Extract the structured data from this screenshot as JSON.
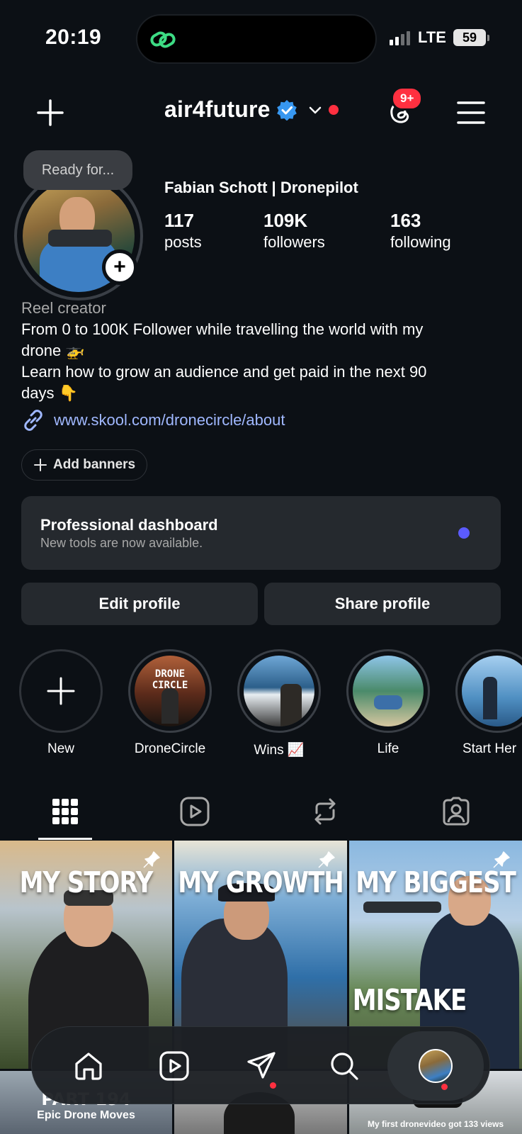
{
  "status_bar": {
    "time": "20:19",
    "network": "LTE",
    "battery": "59"
  },
  "header": {
    "username": "air4future",
    "verified": true,
    "notifications_badge": "9+"
  },
  "profile": {
    "note": "Ready for...",
    "display_name": "Fabian Schott | Dronepilot",
    "stats": [
      {
        "value": "117",
        "label": "posts"
      },
      {
        "value": "109K",
        "label": "followers"
      },
      {
        "value": "163",
        "label": "following"
      }
    ],
    "category": "Reel creator",
    "bio_line1": "From 0 to 100K Follower while travelling the world with my",
    "bio_line2": "drone 🚁",
    "bio_line3": "Learn how to grow an audience and get paid in the next 90",
    "bio_line4": "days 👇",
    "link": "www.skool.com/dronecircle/about"
  },
  "add_banners_label": "Add banners",
  "dashboard": {
    "title": "Professional dashboard",
    "subtitle": "New tools are now available."
  },
  "buttons": {
    "edit": "Edit profile",
    "share": "Share profile"
  },
  "highlights": [
    {
      "label": "New"
    },
    {
      "label": "DroneCircle",
      "cover_text": "DRONE CIRCLE"
    },
    {
      "label": "Wins 📈"
    },
    {
      "label": "Life"
    },
    {
      "label": "Start Her"
    }
  ],
  "grid_posts": [
    {
      "title": "MY STORY"
    },
    {
      "title": "MY GROWTH"
    },
    {
      "title": "MY BIGGEST",
      "title2": "MISTAKE"
    },
    {
      "title": "PART 194",
      "subtitle": "Epic Drone Moves"
    },
    {
      "title": ""
    },
    {
      "title": "",
      "caption": "My first dronevideo got 133 views"
    }
  ],
  "colors": {
    "background": "#0c1015",
    "card": "#25292e",
    "link": "#a0b8ff",
    "notification": "#ff3040",
    "verified": "#3797f0",
    "dashboard_dot": "#5b5bff"
  }
}
